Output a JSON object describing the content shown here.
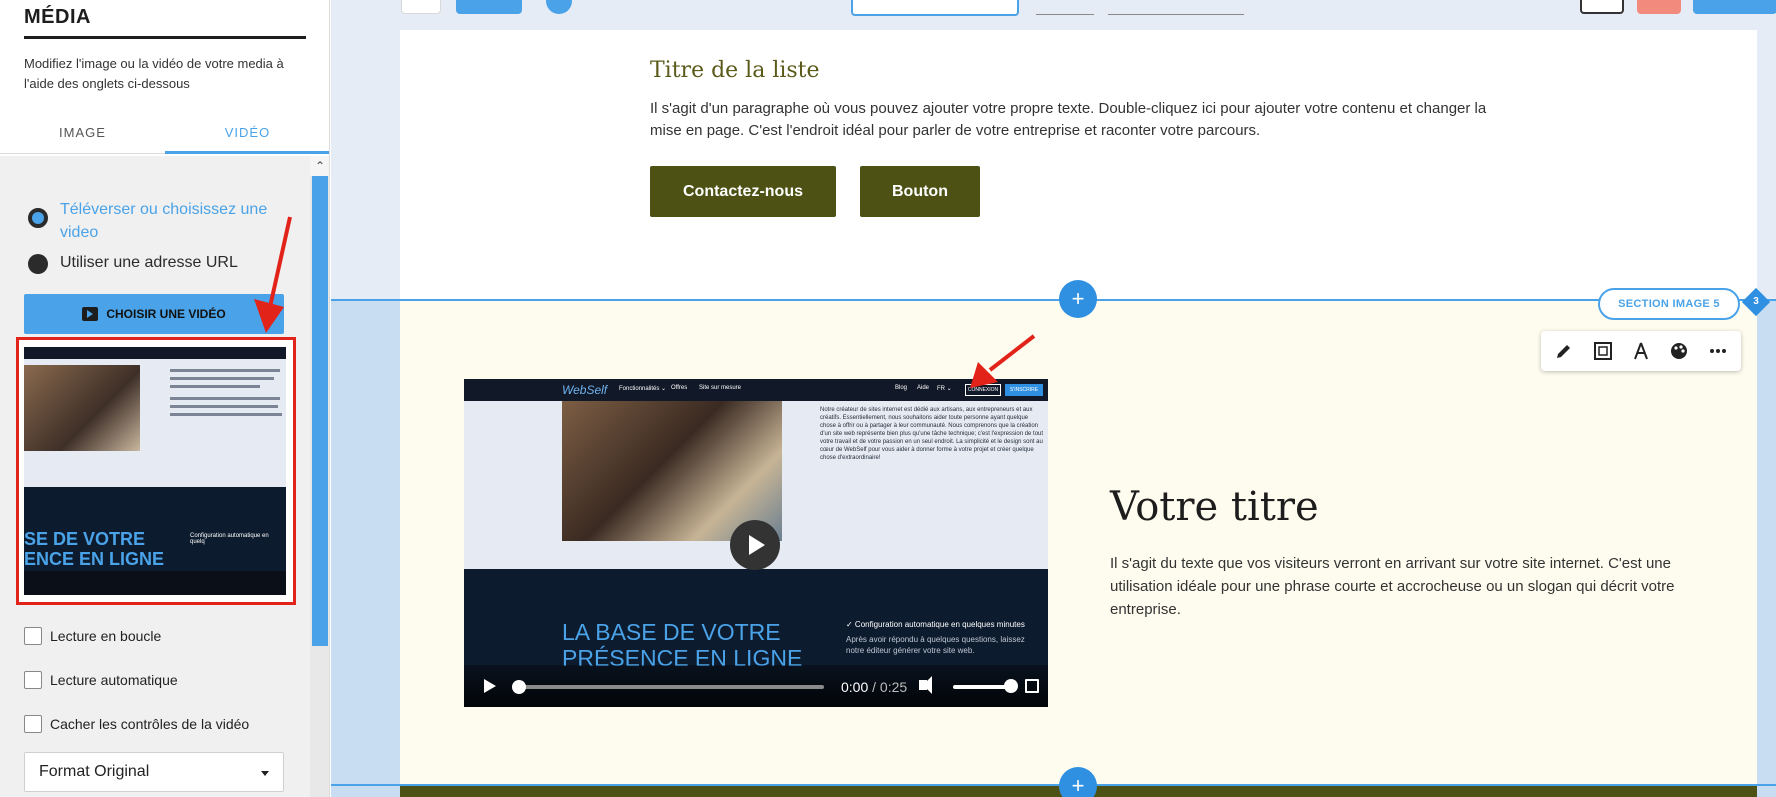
{
  "left_panel": {
    "title": "MÉDIA",
    "description": "Modifiez l'image ou la vidéo de votre media à l'aide des onglets ci-dessous",
    "tabs": [
      {
        "label": "IMAGE",
        "active": false
      },
      {
        "label": "VIDÉO",
        "active": true
      }
    ],
    "radio_upload_label": "Téléverser ou choisissez une video",
    "radio_url_label": "Utiliser une adresse URL",
    "choose_video_label": "CHOISIR UNE VIDÉO",
    "thumbnail": {
      "bottom_text": "SE DE VOTRE ENCE EN LIGNE",
      "check_text": "Configuration automatique en quelq"
    },
    "checkboxes": [
      {
        "label": "Lecture en boucle",
        "checked": false
      },
      {
        "label": "Lecture automatique",
        "checked": false
      },
      {
        "label": "Cacher les contrôles de la vidéo",
        "checked": false
      }
    ],
    "format_select": "Format Original"
  },
  "canvas": {
    "list_section": {
      "title": "Titre de la liste",
      "paragraph": "Il s'agit d'un paragraphe où vous pouvez ajouter votre propre texte. Double-cliquez ici pour ajouter votre contenu et changer la mise en page. C'est l'endroit idéal pour parler de votre entreprise et raconter votre parcours.",
      "buttons": [
        "Contactez-nous",
        "Bouton"
      ]
    },
    "section_badge": "SECTION IMAGE 5",
    "section_count": "3",
    "plus_label": "+",
    "video": {
      "nav_logo": "WebSelf",
      "nav_items": [
        "Fonctionnalités ⌄",
        "Offres",
        "Site sur mesure",
        "Blog",
        "Aide",
        "FR ⌄"
      ],
      "connexion": "CONNEXION",
      "inscrire": "S'INSCRIRE",
      "body_text": "Notre créateur de sites internet est dédié aux artisans, aux entrepreneurs et aux créatifs. Essentiellement, nous souhaitons aider toute personne ayant quelque chose à offrir ou à partager à leur communauté. Nous comprenons que la création d'un site web représente bien plus qu'une tâche technique; c'est l'expression de tout votre travail et de votre passion en un seul endroit. La simplicité et le design sont au cœur de WebSelf pour vous aider à donner forme à votre projet et créer quelque chose d'extraordinaire!",
      "bottom_title": "LA BASE DE VOTRE PRÉSENCE EN LIGNE",
      "check_title": "✓ Configuration automatique en quelques minutes",
      "check_sub": "Après avoir répondu à quelques questions, laissez notre éditeur générer votre site web.",
      "time_current": "0:00",
      "time_separator": "/",
      "time_total": "0:25"
    },
    "hero_title": "Votre titre",
    "hero_paragraph": "Il s'agit du texte que vos visiteurs verront en arrivant sur votre site internet. C'est une utilisation idéale pour une phrase courte et accrocheuse ou un slogan qui décrit votre entreprise."
  },
  "colors": {
    "accent_blue": "#4aa3e8",
    "olive": "#4d5114",
    "highlight_red": "#e2231a",
    "section_bg": "#fefcee"
  },
  "icons": {
    "section_toolbar": [
      "pencil-icon",
      "frame-icon",
      "compass-icon",
      "palette-icon",
      "more-icon"
    ]
  }
}
